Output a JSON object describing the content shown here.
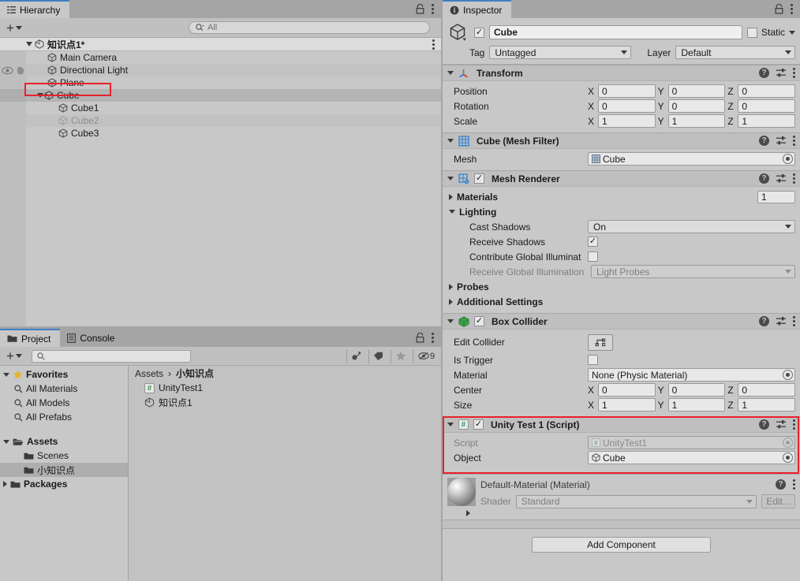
{
  "hierarchy": {
    "tab_label": "Hierarchy",
    "create_button": "+",
    "search": {
      "placeholder": "All",
      "value": ""
    },
    "scene": {
      "label": "知识点1*",
      "icon": "unity-scene-icon"
    },
    "items": [
      {
        "label": "Main Camera",
        "indent": 1,
        "dim": false,
        "expandable": false,
        "selected": false
      },
      {
        "label": "Directional Light",
        "indent": 1,
        "dim": false,
        "expandable": false,
        "selected": false,
        "gutter_icons": [
          "eye-icon",
          "hand-icon"
        ]
      },
      {
        "label": "Plane",
        "indent": 1,
        "dim": false,
        "expandable": false,
        "selected": false
      },
      {
        "label": "Cube",
        "indent": 1,
        "dim": false,
        "expandable": true,
        "selected": true,
        "highlighted": true
      },
      {
        "label": "Cube1",
        "indent": 2,
        "dim": false,
        "expandable": false,
        "selected": false
      },
      {
        "label": "Cube2",
        "indent": 2,
        "dim": true,
        "expandable": false,
        "selected": false
      },
      {
        "label": "Cube3",
        "indent": 2,
        "dim": false,
        "expandable": false,
        "selected": false
      }
    ]
  },
  "project": {
    "tabs": [
      {
        "label": "Project",
        "active": true,
        "icon": "folder-icon"
      },
      {
        "label": "Console",
        "active": false,
        "icon": "console-icon"
      }
    ],
    "create_button": "+",
    "search": {
      "placeholder": "",
      "value": ""
    },
    "hidden_count": "9",
    "tree": [
      {
        "label": "Favorites",
        "indent": 0,
        "icon": "star-icon",
        "expand": "down",
        "bold": true,
        "selected": false
      },
      {
        "label": "All Materials",
        "indent": 1,
        "icon": "search-icon",
        "bold": false,
        "selected": false
      },
      {
        "label": "All Models",
        "indent": 1,
        "icon": "search-icon",
        "bold": false,
        "selected": false
      },
      {
        "label": "All Prefabs",
        "indent": 1,
        "icon": "search-icon",
        "bold": false,
        "selected": false
      },
      {
        "label": "Assets",
        "indent": 0,
        "icon": "folder-open-icon",
        "expand": "down",
        "bold": true,
        "selected": false
      },
      {
        "label": "Scenes",
        "indent": 1,
        "icon": "folder-icon",
        "bold": false,
        "selected": false
      },
      {
        "label": "小知识点",
        "indent": 1,
        "icon": "folder-icon",
        "bold": false,
        "selected": true
      },
      {
        "label": "Packages",
        "indent": 0,
        "icon": "folder-icon",
        "expand": "right",
        "bold": true,
        "selected": false
      }
    ],
    "breadcrumb": {
      "root": "Assets",
      "separator": "›",
      "current": "小知识点"
    },
    "assets": [
      {
        "label": "UnityTest1",
        "icon": "cs-script-icon"
      },
      {
        "label": "知识点1",
        "icon": "unity-scene-icon"
      }
    ]
  },
  "inspector": {
    "tab_label": "Inspector",
    "object": {
      "enabled": true,
      "name": "Cube",
      "static_label": "Static",
      "static_checked": false,
      "tag_label": "Tag",
      "tag_value": "Untagged",
      "layer_label": "Layer",
      "layer_value": "Default"
    },
    "components": [
      {
        "name": "transform",
        "title": "Transform",
        "icon": "transform-axis-icon",
        "expanded": true,
        "has_checkbox": false,
        "rows": [
          {
            "label": "Position",
            "type": "vec3",
            "x": "0",
            "y": "0",
            "z": "0"
          },
          {
            "label": "Rotation",
            "type": "vec3",
            "x": "0",
            "y": "0",
            "z": "0"
          },
          {
            "label": "Scale",
            "type": "vec3",
            "x": "1",
            "y": "1",
            "z": "1"
          }
        ]
      },
      {
        "name": "mesh-filter",
        "title": "Cube (Mesh Filter)",
        "icon": "mesh-filter-icon",
        "expanded": true,
        "has_checkbox": false,
        "rows": [
          {
            "label": "Mesh",
            "type": "object",
            "value": "Cube",
            "value_icon": "mesh-icon"
          }
        ]
      },
      {
        "name": "mesh-renderer",
        "title": "Mesh Renderer",
        "icon": "mesh-renderer-icon",
        "expanded": true,
        "has_checkbox": true,
        "checked": true,
        "rows": [
          {
            "label": "Materials",
            "type": "foldout-count",
            "expand": "right",
            "count": "1"
          },
          {
            "label": "Lighting",
            "type": "foldout",
            "expand": "down"
          },
          {
            "label": "Cast Shadows",
            "type": "dropdown",
            "value": "On",
            "indent": 2
          },
          {
            "label": "Receive Shadows",
            "type": "checkbox",
            "checked": true,
            "indent": 2
          },
          {
            "label": "Contribute Global Illuminat",
            "type": "checkbox",
            "checked": false,
            "indent": 2
          },
          {
            "label": "Receive Global Illumination",
            "type": "dropdown",
            "value": "Light Probes",
            "indent": 2,
            "disabled": true
          },
          {
            "label": "Probes",
            "type": "foldout",
            "expand": "right"
          },
          {
            "label": "Additional Settings",
            "type": "foldout",
            "expand": "right"
          }
        ]
      },
      {
        "name": "box-collider",
        "title": "Box Collider",
        "icon": "box-collider-icon",
        "expanded": true,
        "has_checkbox": true,
        "checked": true,
        "rows": [
          {
            "label": "Edit Collider",
            "type": "button",
            "button_icon": "edit-collider-icon"
          },
          {
            "label": "Is Trigger",
            "type": "checkbox",
            "checked": false
          },
          {
            "label": "Material",
            "type": "object",
            "value": "None (Physic Material)"
          },
          {
            "label": "Center",
            "type": "vec3",
            "x": "0",
            "y": "0",
            "z": "0"
          },
          {
            "label": "Size",
            "type": "vec3",
            "x": "1",
            "y": "1",
            "z": "1"
          }
        ]
      },
      {
        "name": "unity-test-1-script",
        "title": "Unity Test 1 (Script)",
        "icon": "cs-script-icon",
        "expanded": true,
        "has_checkbox": true,
        "checked": true,
        "highlighted": true,
        "rows": [
          {
            "label": "Script",
            "type": "object",
            "value": "UnityTest1",
            "value_icon": "cs-script-icon",
            "disabled": true
          },
          {
            "label": "Object",
            "type": "object",
            "value": "Cube",
            "value_icon": "cube-icon"
          }
        ]
      }
    ],
    "material_preview": {
      "title": "Default-Material (Material)",
      "shader_label": "Shader",
      "shader_value": "Standard",
      "edit_label": "Edit..."
    },
    "add_component_label": "Add Component"
  },
  "colors": {
    "panel_bg": "#c8c8c8",
    "tabbar_bg": "#a5a5a5",
    "header_bg": "#bfbfbf",
    "field_bg": "#e8e8e8",
    "highlight_red": "#e8212a",
    "active_tab_accent": "#3f7ec4",
    "selection": "#b4b4b4"
  }
}
